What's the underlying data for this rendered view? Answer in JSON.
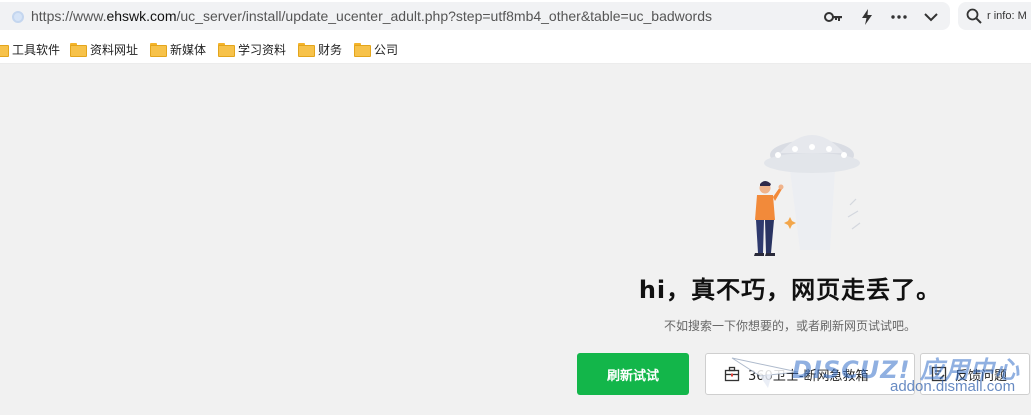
{
  "browser": {
    "url_scheme_host_prefix": "https://www.",
    "url_host": "ehswk.com",
    "url_path": "/uc_server/install/update_ucenter_adult.php?step=utf8mb4_other&table=uc_badwords",
    "search_text": "r info: M",
    "tools": [
      "key-icon",
      "lightning-icon",
      "more-icon",
      "chevron-down-icon"
    ]
  },
  "bookmarks": [
    {
      "label": "工具软件",
      "icon": "folder-icon"
    },
    {
      "label": "资料网址",
      "icon": "folder-icon"
    },
    {
      "label": "新媒体",
      "icon": "folder-icon"
    },
    {
      "label": "学习资料",
      "icon": "folder-icon"
    },
    {
      "label": "财务",
      "icon": "folder-icon"
    },
    {
      "label": "公司",
      "icon": "folder-icon"
    }
  ],
  "error_page": {
    "title": "hi，真不巧，网页走丢了。",
    "subtitle": "不如搜索一下你想要的，或者刷新网页试试吧。",
    "retry_label": "刷新试试",
    "rescue_label": "360卫士-断网急救箱",
    "feedback_label": "反馈问题"
  },
  "watermark": {
    "logo_text": "DISCUZ! 应用中心",
    "domain": "addon.dismall.com"
  },
  "colors": {
    "accent_green": "#13b64a",
    "page_bg": "#f1f1f1",
    "folder": "#f7c24a"
  }
}
